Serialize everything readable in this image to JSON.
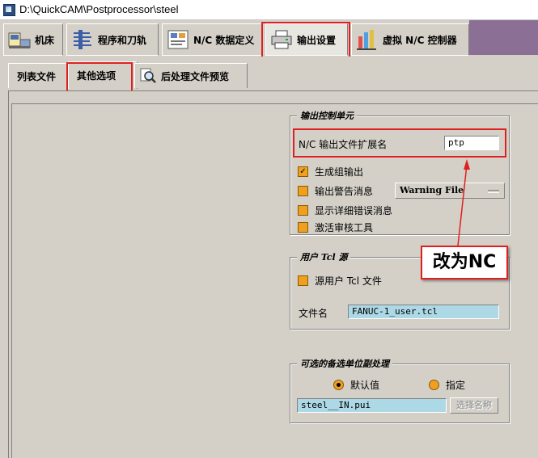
{
  "window": {
    "title": "D:\\QuickCAM\\Postprocessor\\steel"
  },
  "main_tabs": [
    {
      "label": "机床",
      "icon": "machine-icon"
    },
    {
      "label": "程序和刀轨",
      "icon": "program-toolpath-icon"
    },
    {
      "label": "N/C 数据定义",
      "icon": "nc-data-icon"
    },
    {
      "label": "输出设置",
      "icon": "printer-icon"
    },
    {
      "label": "虚拟 N/C 控制器",
      "icon": "virtual-controller-icon"
    }
  ],
  "sub_tabs": [
    {
      "label": "列表文件"
    },
    {
      "label": "其他选项"
    },
    {
      "label": "后处理文件预览",
      "icon": "magnifier-icon"
    }
  ],
  "output_control": {
    "title": "输出控制单元",
    "ext_label": "N/C 输出文件扩展名",
    "ext_value": "ptp",
    "options": [
      {
        "label": "生成组输出",
        "checked": true
      },
      {
        "label": "输出警告消息",
        "checked": false
      },
      {
        "label": "显示详细错误消息",
        "checked": false
      },
      {
        "label": "激活审核工具",
        "checked": false
      }
    ],
    "warning_select": "Warning File"
  },
  "user_tcl": {
    "title": "用户 Tcl 源",
    "source_label": "源用户 Tcl 文件",
    "filename_label": "文件名",
    "filename_value": "FANUC-1_user.tcl"
  },
  "unit_handling": {
    "title": "可选的备选单位副处理",
    "radio_default": "默认值",
    "radio_specify": "指定",
    "selected": "默认值",
    "file_value": "steel__IN.pui",
    "select_name_button": "选择名称"
  },
  "annotation": {
    "text": "改为NC"
  },
  "colors": {
    "highlight_red": "#e02020",
    "checkbox_orange": "#f0a020",
    "field_blue": "#add8e6",
    "tab_filler": "#8c6f95"
  }
}
